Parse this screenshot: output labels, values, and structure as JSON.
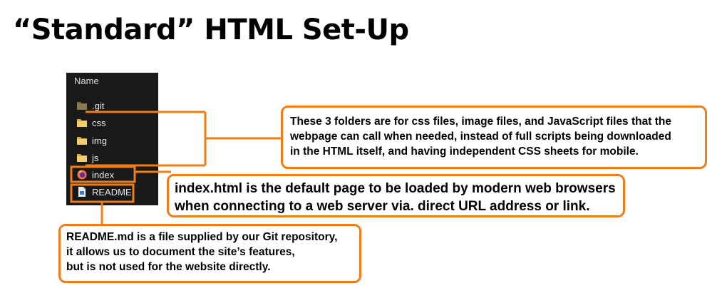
{
  "title": "“Standard” HTML Set-Up",
  "explorer": {
    "header": "Name",
    "items": [
      {
        "label": ".git",
        "icon": "folder-icon"
      },
      {
        "label": "css",
        "icon": "folder-icon"
      },
      {
        "label": "img",
        "icon": "folder-icon"
      },
      {
        "label": "js",
        "icon": "folder-icon"
      },
      {
        "label": "index",
        "icon": "firefox-icon"
      },
      {
        "label": "README",
        "icon": "document-icon"
      }
    ]
  },
  "callouts": {
    "folders": [
      "These 3 folders are for css files, image files, and JavaScript files that the",
      "webpage can call when needed, instead of full scripts being downloaded",
      "in the HTML itself, and having independent CSS sheets for mobile."
    ],
    "index": [
      "index.html is the default page to be loaded by modern web browsers",
      "when connecting to a web server via. direct URL address or link."
    ],
    "readme": [
      "README.md is a file supplied by our Git repository,",
      "it allows us to document the site’s features,",
      "but is not used for the website directly."
    ]
  },
  "colors": {
    "accent": "#ef7d1a",
    "explorer_bg": "#191919",
    "folder": "#e8c46a",
    "git_folder": "#8a7a4e"
  }
}
